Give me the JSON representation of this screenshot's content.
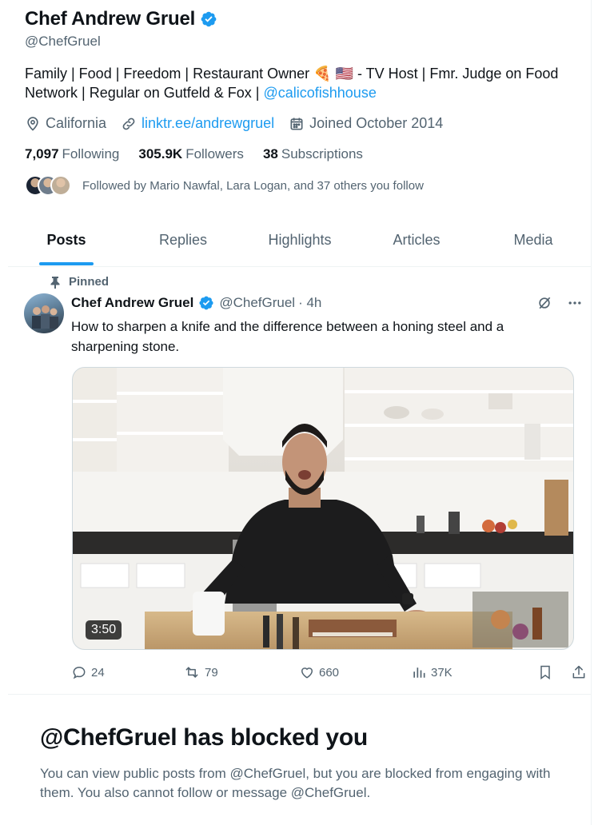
{
  "profile": {
    "name": "Chef Andrew Gruel",
    "handle": "@ChefGruel",
    "bio_part1": "Family | Food | Freedom | Restaurant Owner ",
    "bio_emoji": "🍕 🇺🇸",
    "bio_part2": " - TV Host | Fmr. Judge on Food Network | Regular on Gutfeld & Fox | ",
    "bio_link": "@calicofishhouse",
    "location": "California",
    "website": "linktr.ee/andrewgruel",
    "joined": "Joined October 2014",
    "following_count": "7,097",
    "following_label": "Following",
    "followers_count": "305.9K",
    "followers_label": "Followers",
    "subscriptions_count": "38",
    "subscriptions_label": "Subscriptions",
    "followed_by": "Followed by Mario Nawfal, Lara Logan, and 37 others you follow"
  },
  "tabs": [
    "Posts",
    "Replies",
    "Highlights",
    "Articles",
    "Media"
  ],
  "post": {
    "pinned_label": "Pinned",
    "author_name": "Chef Andrew Gruel",
    "author_handle": "@ChefGruel",
    "time": "· 4h",
    "text": "How to sharpen a knife and the difference between a honing steel and a sharpening stone.",
    "video_duration": "3:50",
    "replies": "24",
    "reposts": "79",
    "likes": "660",
    "views": "37K"
  },
  "blocked": {
    "title": "@ChefGruel has blocked you",
    "message": "You can view public posts from @ChefGruel, but you are blocked from engaging with them. You also cannot follow or message @ChefGruel."
  },
  "colors": {
    "accent": "#1d9bf0",
    "text": "#0f1419",
    "secondary": "#536471"
  }
}
